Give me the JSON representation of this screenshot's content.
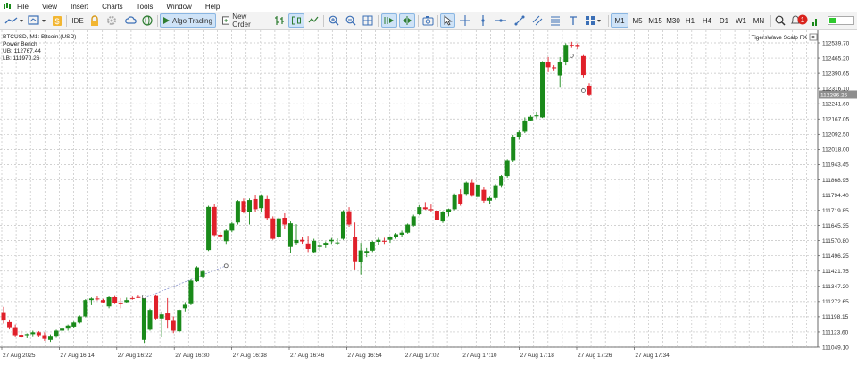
{
  "menu": [
    "File",
    "View",
    "Insert",
    "Charts",
    "Tools",
    "Window",
    "Help"
  ],
  "toolbar": {
    "ide_label": "IDE",
    "algo_trading_label": "Algo Trading",
    "new_order_label": "New Order",
    "timeframes": [
      "M1",
      "M5",
      "M15",
      "M30",
      "H1",
      "H4",
      "D1",
      "W1",
      "MN"
    ],
    "active_timeframe": "M1",
    "notification_count": "1"
  },
  "chart_info": {
    "symbol_line": "BTCUSD, M1:  Bitcoin (USD)",
    "indicator_name": "Power Bench",
    "ub_label": "UB: 112767.44",
    "lb_label": "LB: 111970.26",
    "ea_label": "TigersWave Scalp FX"
  },
  "colors": {
    "bull": "#1a8a1a",
    "bear": "#e0202a",
    "grid": "#c2c2c2",
    "price_tag_bg": "#8e8e8e",
    "trade_line": "#7a86c8"
  },
  "chart_data": {
    "type": "candlestick",
    "symbol": "BTCUSD",
    "timeframe": "M1",
    "price_axis": [
      "112539.70",
      "112465.20",
      "112390.65",
      "112316.10",
      "112241.60",
      "112167.05",
      "112092.50",
      "112018.00",
      "111943.45",
      "111868.95",
      "111794.40",
      "111719.85",
      "111645.35",
      "111570.80",
      "111496.25",
      "111421.75",
      "111347.20",
      "111272.65",
      "111198.15",
      "111123.60",
      "111049.10"
    ],
    "y_range": [
      111049.1,
      112539.7
    ],
    "current_price_label": "112286.25",
    "time_axis": [
      "27 Aug 2025",
      "27 Aug 16:14",
      "27 Aug 16:22",
      "27 Aug 16:30",
      "27 Aug 16:38",
      "27 Aug 16:46",
      "27 Aug 16:54",
      "27 Aug 17:02",
      "27 Aug 17:10",
      "27 Aug 17:18",
      "27 Aug 17:26",
      "27 Aug 17:34"
    ],
    "ohlc": [
      [
        111217,
        111247,
        111165,
        111180
      ],
      [
        111172,
        111185,
        111136,
        111147
      ],
      [
        111147,
        111160,
        111102,
        111108
      ],
      [
        111110,
        111130,
        111094,
        111100
      ],
      [
        111108,
        111117,
        111093,
        111113
      ],
      [
        111113,
        111130,
        111103,
        111122
      ],
      [
        111122,
        111128,
        111100,
        111108
      ],
      [
        111108,
        111122,
        111080,
        111090
      ],
      [
        111085,
        111112,
        111075,
        111105
      ],
      [
        111105,
        111135,
        111095,
        111130
      ],
      [
        111130,
        111147,
        111120,
        111140
      ],
      [
        111140,
        111160,
        111130,
        111155
      ],
      [
        111150,
        111175,
        111145,
        111170
      ],
      [
        111170,
        111205,
        111165,
        111200
      ],
      [
        111200,
        111285,
        111195,
        111280
      ],
      [
        111280,
        111293,
        111255,
        111288
      ],
      [
        111288,
        111298,
        111278,
        111284
      ],
      [
        111280,
        111287,
        111264,
        111269
      ],
      [
        111249,
        111298,
        111240,
        111294
      ],
      [
        111294,
        111300,
        111260,
        111267
      ],
      [
        111264,
        111290,
        111240,
        111260
      ],
      [
        111270,
        111292,
        111265,
        111280
      ],
      [
        111290,
        111297,
        111282,
        111288
      ],
      [
        111295,
        111302,
        111290,
        111293
      ],
      [
        111085,
        111305,
        111070,
        111290
      ],
      [
        111135,
        111238,
        111130,
        111232
      ],
      [
        111300,
        111308,
        111185,
        111190
      ],
      [
        111190,
        111225,
        111100,
        111210
      ],
      [
        111215,
        111290,
        111140,
        111180
      ],
      [
        111178,
        111200,
        111118,
        111130
      ],
      [
        111127,
        111235,
        111122,
        111232
      ],
      [
        111240,
        111270,
        111225,
        111257
      ],
      [
        111260,
        111380,
        111255,
        111375
      ],
      [
        111372,
        111446,
        111368,
        111440
      ],
      [
        111395,
        111425,
        111385,
        111420
      ],
      [
        111525,
        111742,
        111520,
        111736
      ],
      [
        111736,
        111752,
        111593,
        111598
      ],
      [
        111600,
        111612,
        111575,
        111592
      ],
      [
        111568,
        111630,
        111555,
        111620
      ],
      [
        111620,
        111662,
        111612,
        111655
      ],
      [
        111660,
        111770,
        111650,
        111765
      ],
      [
        111765,
        111778,
        111704,
        111710
      ],
      [
        111710,
        111778,
        111650,
        111770
      ],
      [
        111775,
        111796,
        111710,
        111725
      ],
      [
        111730,
        111798,
        111710,
        111790
      ],
      [
        111775,
        111790,
        111670,
        111682
      ],
      [
        111680,
        111690,
        111575,
        111580
      ],
      [
        111590,
        111685,
        111580,
        111680
      ],
      [
        111683,
        111705,
        111630,
        111650
      ],
      [
        111540,
        111665,
        111510,
        111656
      ],
      [
        111560,
        111652,
        111550,
        111574
      ],
      [
        111575,
        111589,
        111556,
        111567
      ],
      [
        111557,
        111595,
        111515,
        111530
      ],
      [
        111515,
        111580,
        111508,
        111570
      ],
      [
        111540,
        111565,
        111520,
        111546
      ],
      [
        111548,
        111567,
        111535,
        111560
      ],
      [
        111568,
        111584,
        111555,
        111575
      ],
      [
        111560,
        111582,
        111550,
        111562
      ],
      [
        111580,
        111720,
        111575,
        111715
      ],
      [
        111715,
        111735,
        111640,
        111650
      ],
      [
        111590,
        111660,
        111430,
        111470
      ],
      [
        111466,
        111560,
        111405,
        111523
      ],
      [
        111510,
        111535,
        111490,
        111520
      ],
      [
        111522,
        111570,
        111515,
        111565
      ],
      [
        111565,
        111585,
        111550,
        111575
      ],
      [
        111570,
        111585,
        111555,
        111567
      ],
      [
        111575,
        111593,
        111560,
        111588
      ],
      [
        111590,
        111608,
        111580,
        111602
      ],
      [
        111600,
        111620,
        111590,
        111610
      ],
      [
        111610,
        111655,
        111605,
        111650
      ],
      [
        111645,
        111698,
        111640,
        111690
      ],
      [
        111700,
        111745,
        111695,
        111735
      ],
      [
        111734,
        111760,
        111722,
        111725
      ],
      [
        111725,
        111748,
        111712,
        111720
      ],
      [
        111718,
        111732,
        111663,
        111670
      ],
      [
        111665,
        111716,
        111658,
        111710
      ],
      [
        111710,
        111728,
        111690,
        111725
      ],
      [
        111725,
        111802,
        111720,
        111797
      ],
      [
        111800,
        111822,
        111742,
        111750
      ],
      [
        111800,
        111860,
        111790,
        111855
      ],
      [
        111855,
        111868,
        111786,
        111790
      ],
      [
        111785,
        111850,
        111775,
        111845
      ],
      [
        111820,
        111835,
        111757,
        111767
      ],
      [
        111767,
        111786,
        111752,
        111780
      ],
      [
        111780,
        111848,
        111772,
        111842
      ],
      [
        111842,
        111893,
        111830,
        111888
      ],
      [
        111888,
        111970,
        111880,
        111965
      ],
      [
        111965,
        112090,
        111958,
        112080
      ],
      [
        112080,
        112110,
        112065,
        112102
      ],
      [
        112105,
        112175,
        112098,
        112160
      ],
      [
        112160,
        112185,
        112155,
        112178
      ],
      [
        112180,
        112200,
        112170,
        112185
      ],
      [
        112175,
        112450,
        112172,
        112445
      ],
      [
        112445,
        112470,
        112396,
        112420
      ],
      [
        112420,
        112430,
        112405,
        112415
      ],
      [
        112380,
        112470,
        112320,
        112445
      ],
      [
        112445,
        112538,
        112430,
        112530
      ],
      [
        112530,
        112545,
        112515,
        112525
      ],
      [
        112530,
        112538,
        112510,
        112520
      ],
      [
        112475,
        112480,
        112370,
        112382
      ],
      [
        112330,
        112342,
        112282,
        112287
      ]
    ],
    "trade_line": {
      "from_index": 24,
      "from_price": 111290,
      "to_index": 38,
      "to_price": 111448
    },
    "markers": [
      {
        "index": 24,
        "price": 111296
      },
      {
        "index": 38,
        "price": 111448
      },
      {
        "index": 97,
        "price": 112477
      },
      {
        "index": 99,
        "price": 112306
      }
    ]
  }
}
